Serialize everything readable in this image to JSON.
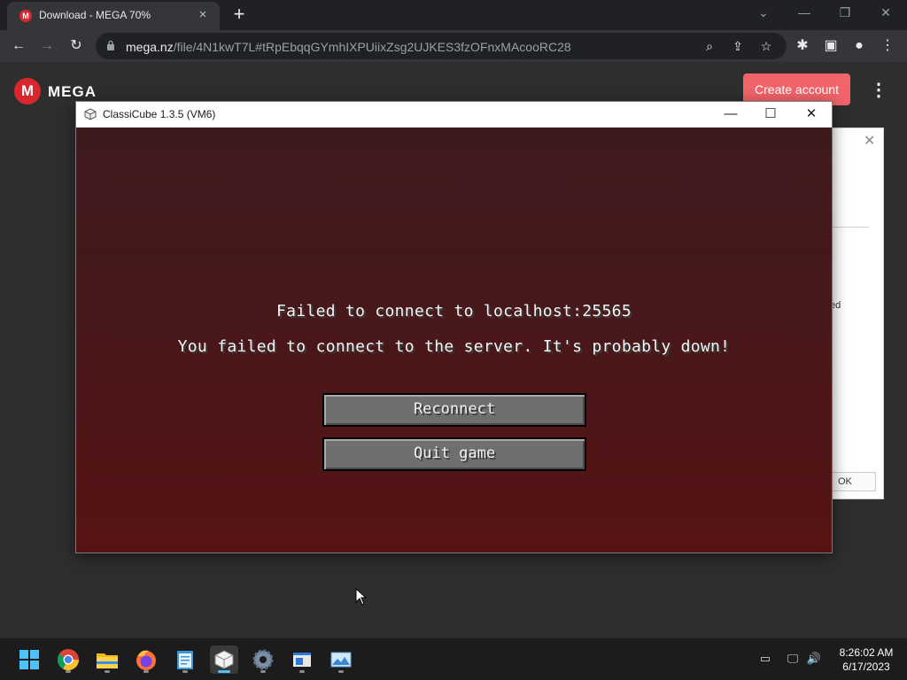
{
  "browser": {
    "tab": {
      "title": "Download - MEGA 70%",
      "favicon": "M"
    },
    "url": {
      "host": "mega.nz",
      "path": "/file/4N1kwT7L#tRpEbqqGYmhIXPUiixZsg2UJKES3fzOFnxMAcooRC28"
    }
  },
  "mega": {
    "logo_letter": "M",
    "brand": "MEGA",
    "create_account_label": "Create account",
    "side_dialog": {
      "partial_text": "ed",
      "ok_label": "OK"
    }
  },
  "classicube": {
    "window_title": "ClassiCube 1.3.5 (VM6)",
    "error_title": "Failed to connect to localhost:25565",
    "error_message": "You failed to connect to the server. It's probably down!",
    "reconnect_label": "Reconnect",
    "quit_label": "Quit game"
  },
  "taskbar": {
    "apps": [
      "start-icon",
      "chrome-icon",
      "file-explorer-icon",
      "firefox-icon",
      "notepad-icon",
      "classicube-icon",
      "settings-icon",
      "app-window-icon",
      "image-viewer-icon"
    ],
    "active_app": "classicube-icon",
    "time": "8:26:02 AM",
    "date": "6/17/2023"
  },
  "colors": {
    "mega_red": "#d9272e",
    "create_account_bg": "#f0646a",
    "game_bg_top": "#3e1a1d",
    "game_bg_bottom": "#571314",
    "button_gray": "#6f6f6f",
    "taskbar_active": "#4cc2ff"
  }
}
